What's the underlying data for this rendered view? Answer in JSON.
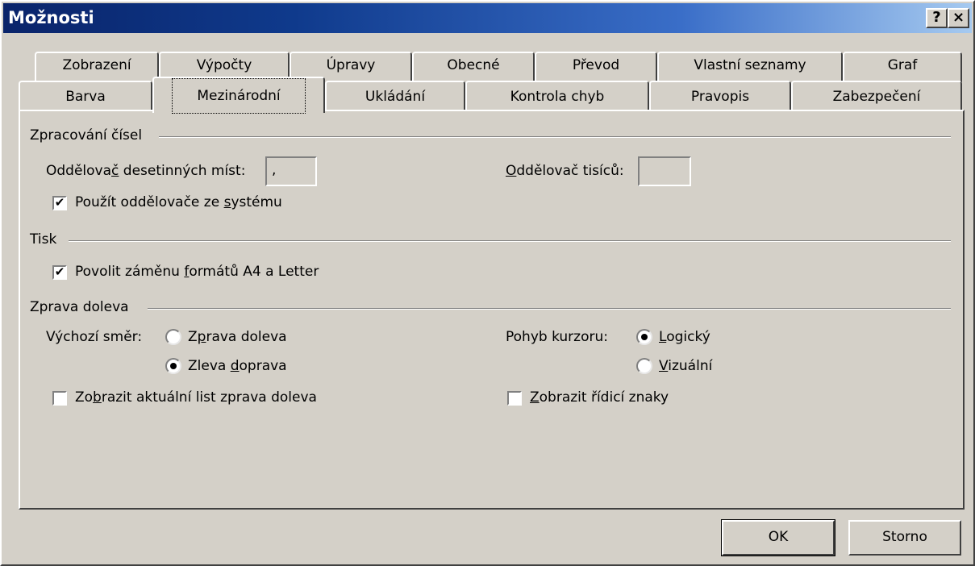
{
  "window": {
    "title": "Možnosti",
    "help_label": "?",
    "close_label": "×"
  },
  "tabs_row1": [
    "Zobrazení",
    "Výpočty",
    "Úpravy",
    "Obecné",
    "Převod",
    "Vlastní seznamy",
    "Graf"
  ],
  "tabs_row2": [
    "Barva",
    "Mezinárodní",
    "Ukládání",
    "Kontrola chyb",
    "Pravopis",
    "Zabezpečení"
  ],
  "active_tab": "Mezinárodní",
  "number_handling": {
    "group_label": "Zpracování čísel",
    "decimal_sep_label": "Oddělovač desetinných míst:",
    "decimal_sep_value": ",",
    "thousands_sep_label": "Oddělovač tisíců:",
    "thousands_sep_value": "",
    "use_system_label": "Použít oddělovače ze systému",
    "use_system_checked": true
  },
  "printing": {
    "group_label": "Tisk",
    "allow_a4_letter_label": "Povolit záměnu formátů A4 a Letter",
    "allow_a4_letter_checked": true
  },
  "rtl": {
    "group_label": "Zprava doleva",
    "default_direction_label": "Výchozí směr:",
    "dir_rtl_label": "Zprava doleva",
    "dir_ltr_label": "Zleva doprava",
    "selected_direction": "ltr",
    "cursor_movement_label": "Pohyb kurzoru:",
    "cursor_logical_label": "Logický",
    "cursor_visual_label": "Vizuální",
    "selected_cursor": "logical",
    "show_sheet_rtl_label": "Zobrazit aktuální list zprava doleva",
    "show_sheet_rtl_checked": false,
    "show_control_chars_label": "Zobrazit řídicí znaky",
    "show_control_chars_checked": false
  },
  "buttons": {
    "ok_label": "OK",
    "cancel_label": "Storno"
  }
}
